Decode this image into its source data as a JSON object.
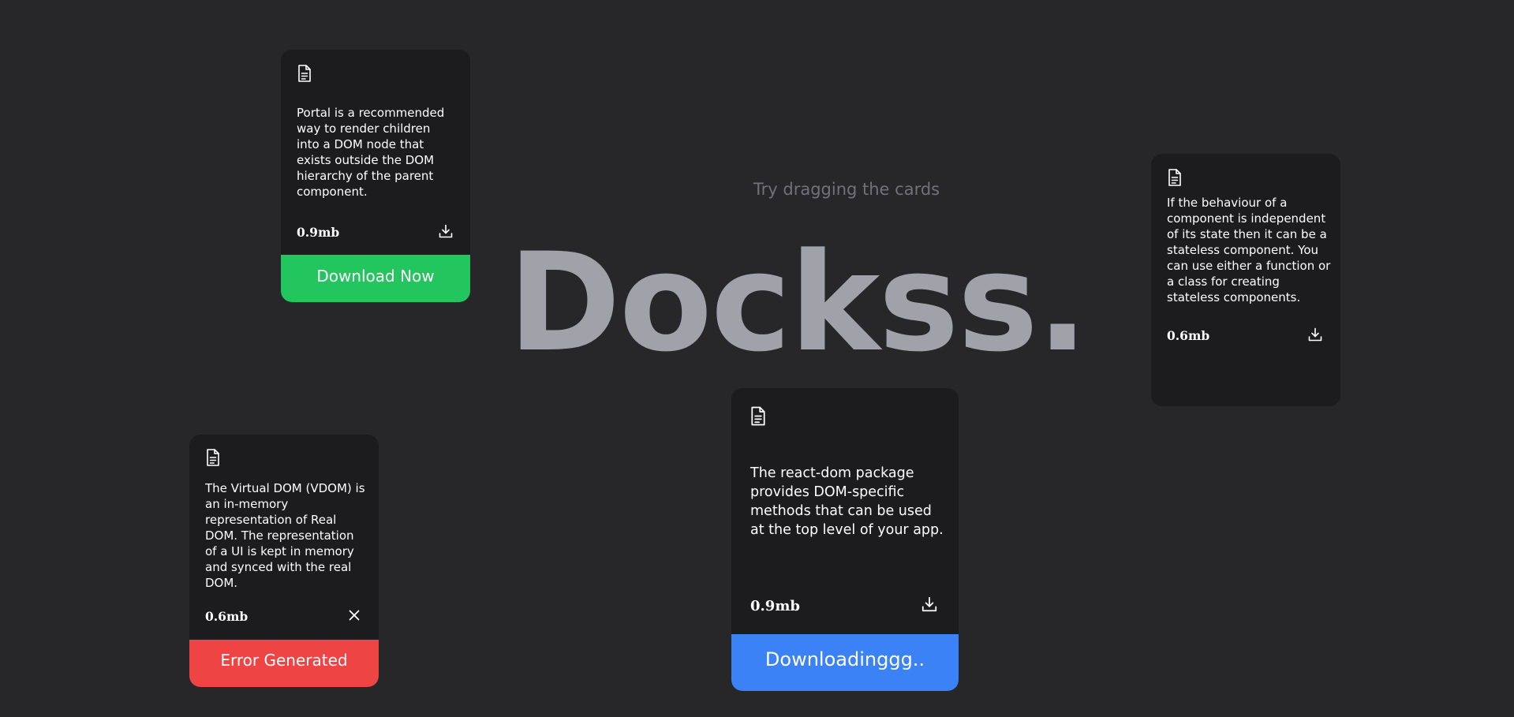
{
  "hint": "Try dragging the cards",
  "title": "Dockss.",
  "icons": {
    "document": "document-icon",
    "download": "download-icon",
    "close": "close-icon"
  },
  "colors": {
    "background": "#27272a",
    "card": "#1c1c1e",
    "title": "#a1a1aa",
    "hint": "#71717a",
    "success": "#22c55e",
    "error": "#ef4444",
    "progress": "#3b82f6"
  },
  "cards": [
    {
      "description": "Portal is a recommended way to render children into a DOM node that exists outside the DOM hierarchy of the parent component.",
      "size": "0.9mb",
      "action_icon": "download-icon",
      "bar_label": "Download Now",
      "bar_color": "#22c55e"
    },
    {
      "description": "If the behaviour of a component is independent of its state then it can be a stateless component. You can use either a function or a class for creating stateless components.",
      "size": "0.6mb",
      "action_icon": "download-icon"
    },
    {
      "description": "The Virtual DOM (VDOM) is an in-memory representation of Real DOM. The representation of a UI is kept in memory and synced with the real DOM.",
      "size": "0.6mb",
      "action_icon": "close-icon",
      "bar_label": "Error Generated",
      "bar_color": "#ef4444"
    },
    {
      "description": "The react-dom package provides DOM-specific methods that can be used at the top level of your app.",
      "size": "0.9mb",
      "action_icon": "download-icon",
      "bar_label": "Downloadinggg..",
      "bar_color": "#3b82f6"
    }
  ]
}
